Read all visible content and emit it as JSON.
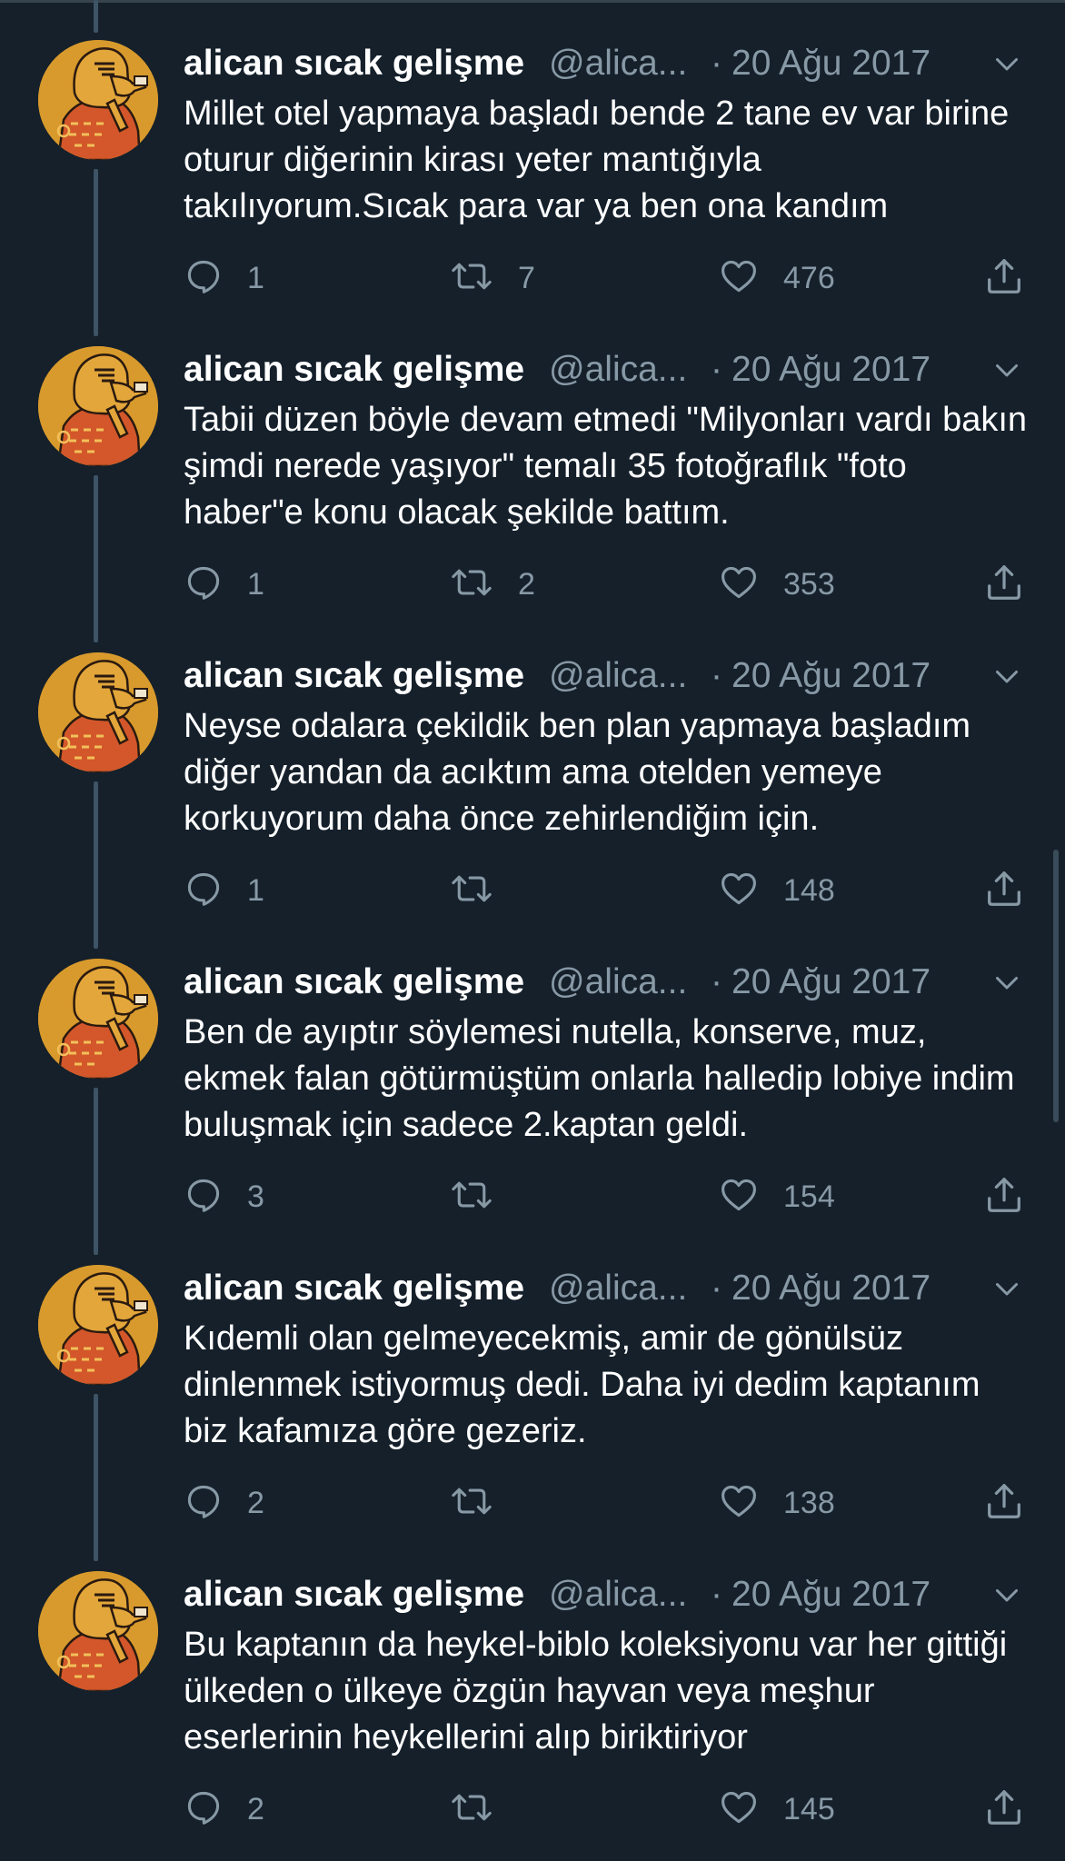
{
  "colors": {
    "background": "#15202b",
    "text_primary": "#ffffff",
    "text_secondary": "#8899a6",
    "thread_line": "#3d5466",
    "avatar_bg": "#d89a2c"
  },
  "tweets": [
    {
      "name": "alican sıcak gelişme",
      "handle": "@alica...",
      "dot": "·",
      "date": "20 Ağu 2017",
      "text": "Millet otel yapmaya başladı bende 2 tane ev var birine oturur diğerinin kirası yeter mantığıyla takılıyorum.Sıcak para var ya ben ona kandım",
      "replies": "1",
      "retweets": "7",
      "likes": "476"
    },
    {
      "name": "alican sıcak gelişme",
      "handle": "@alica...",
      "dot": "·",
      "date": "20 Ağu 2017",
      "text": "Tabii düzen böyle devam etmedi \"Milyonları vardı bakın şimdi nerede yaşıyor\" temalı 35 fotoğraflık \"foto haber\"e konu olacak şekilde battım.",
      "replies": "1",
      "retweets": "2",
      "likes": "353"
    },
    {
      "name": "alican sıcak gelişme",
      "handle": "@alica...",
      "dot": "·",
      "date": "20 Ağu 2017",
      "text": "Neyse odalara çekildik ben plan yapmaya başladım diğer yandan da acıktım ama otelden yemeye korkuyorum daha önce zehirlendiğim için.",
      "replies": "1",
      "retweets": "",
      "likes": "148"
    },
    {
      "name": "alican sıcak gelişme",
      "handle": "@alica...",
      "dot": "·",
      "date": "20 Ağu 2017",
      "text": "Ben de ayıptır söylemesi nutella, konserve, muz, ekmek falan götürmüştüm onlarla halledip lobiye indim buluşmak için sadece 2.kaptan geldi.",
      "replies": "3",
      "retweets": "",
      "likes": "154"
    },
    {
      "name": "alican sıcak gelişme",
      "handle": "@alica...",
      "dot": "·",
      "date": "20 Ağu 2017",
      "text": "Kıdemli olan gelmeyecekmiş, amir de gönülsüz dinlenmek istiyormuş dedi. Daha iyi dedim kaptanım biz kafamıza göre gezeriz.",
      "replies": "2",
      "retweets": "",
      "likes": "138"
    },
    {
      "name": "alican sıcak gelişme",
      "handle": "@alica...",
      "dot": "·",
      "date": "20 Ağu 2017",
      "text": "Bu kaptanın da heykel-biblo koleksiyonu var her gittiği ülkeden o ülkeye özgün hayvan veya meşhur eserlerinin heykellerini alıp biriktiriyor",
      "replies": "2",
      "retweets": "",
      "likes": "145"
    }
  ]
}
